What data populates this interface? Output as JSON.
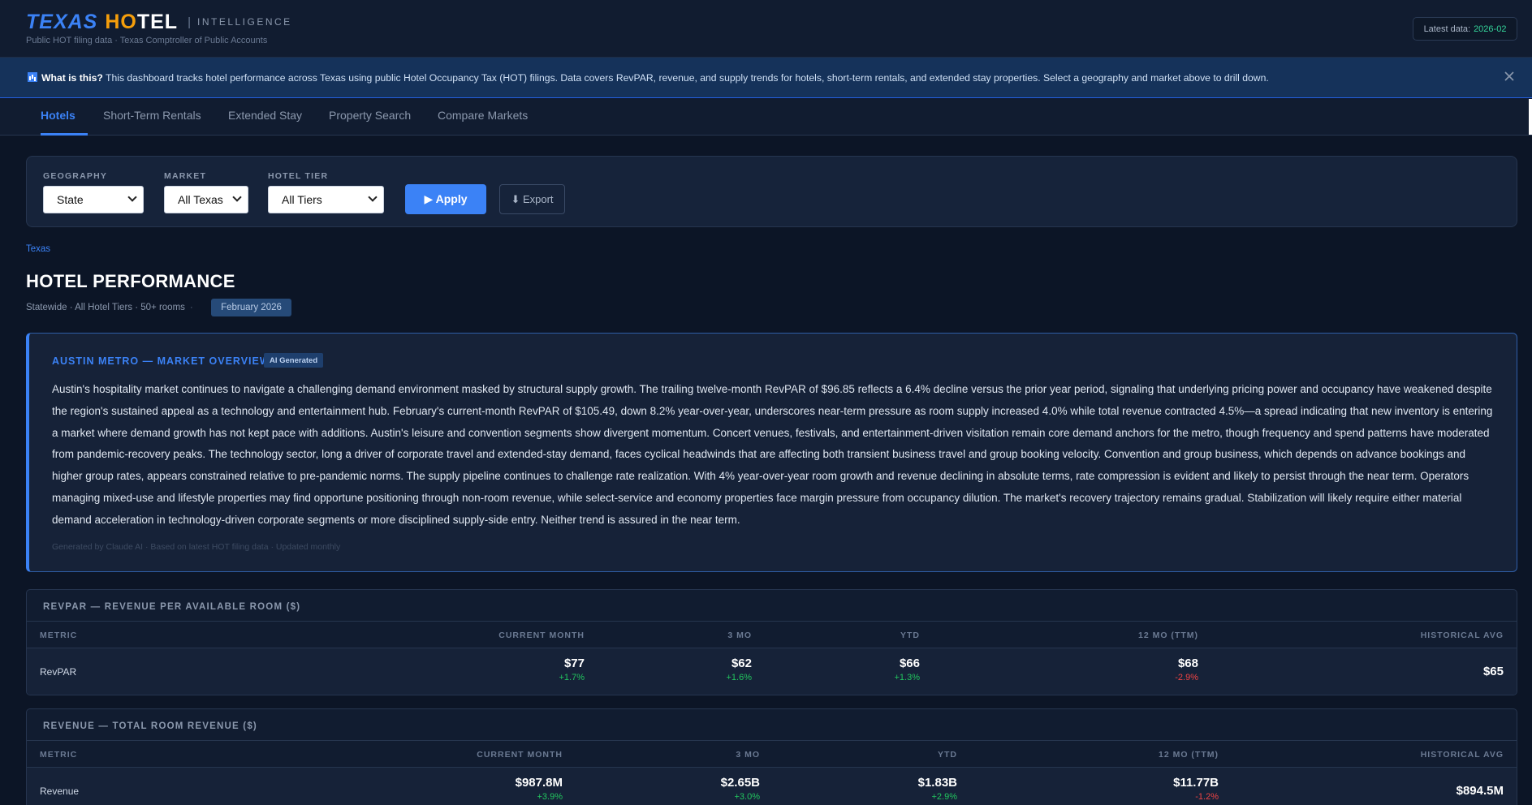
{
  "header": {
    "logo_texas": "TEXAS",
    "logo_hotel_a": "HO",
    "logo_hotel_b": "TEL",
    "logo_sep": "|",
    "logo_intel": "INTELLIGENCE",
    "subtitle": "Public HOT filing data · Texas Comptroller of Public Accounts",
    "latest_label": "Latest data:",
    "latest_value": "2026-02"
  },
  "banner": {
    "icon": "bar-chart-icon",
    "question": "What is this?",
    "text": " This dashboard tracks hotel performance across Texas using public Hotel Occupancy Tax (HOT) filings. Data covers RevPAR, revenue, and supply trends for hotels, short-term rentals, and extended stay properties. Select a geography and market above to drill down."
  },
  "tabs": [
    {
      "label": "Hotels"
    },
    {
      "label": "Short-Term Rentals"
    },
    {
      "label": "Extended Stay"
    },
    {
      "label": "Property Search"
    },
    {
      "label": "Compare Markets"
    }
  ],
  "filters": {
    "geography_label": "GEOGRAPHY",
    "geography_value": "State",
    "market_label": "MARKET",
    "market_value": "All Texas",
    "tier_label": "HOTEL TIER",
    "tier_value": "All Tiers",
    "apply_label": "▶ Apply",
    "export_label": "⬇ Export"
  },
  "page": {
    "breadcrumb": "Texas",
    "title": "HOTEL PERFORMANCE",
    "subtitle": "Statewide · All Hotel Tiers · 50+ rooms",
    "subtitle_dot": "·",
    "period": "February 2026"
  },
  "overview": {
    "title": "AUSTIN METRO — MARKET OVERVIEW",
    "badge": "AI Generated",
    "body": "Austin's hospitality market continues to navigate a challenging demand environment masked by structural supply growth. The trailing twelve-month RevPAR of $96.85 reflects a 6.4% decline versus the prior year period, signaling that underlying pricing power and occupancy have weakened despite the region's sustained appeal as a technology and entertainment hub. February's current-month RevPAR of $105.49, down 8.2% year-over-year, underscores near-term pressure as room supply increased 4.0% while total revenue contracted 4.5%—a spread indicating that new inventory is entering a market where demand growth has not kept pace with additions. Austin's leisure and convention segments show divergent momentum. Concert venues, festivals, and entertainment-driven visitation remain core demand anchors for the metro, though frequency and spend patterns have moderated from pandemic-recovery peaks. The technology sector, long a driver of corporate travel and extended-stay demand, faces cyclical headwinds that are affecting both transient business travel and group booking velocity. Convention and group business, which depends on advance bookings and higher group rates, appears constrained relative to pre-pandemic norms. The supply pipeline continues to challenge rate realization. With 4% year-over-year room growth and revenue declining in absolute terms, rate compression is evident and likely to persist through the near term. Operators managing mixed-use and lifestyle properties may find opportune positioning through non-room revenue, while select-service and economy properties face margin pressure from occupancy dilution. The market's recovery trajectory remains gradual. Stabilization will likely require either material demand acceleration in technology-driven corporate segments or more disciplined supply-side entry. Neither trend is assured in the near term.",
    "footer": "Generated by Claude AI · Based on latest HOT filing data · Updated monthly"
  },
  "revpar_table": {
    "title": "REVPAR — REVENUE PER AVAILABLE ROOM ($)",
    "headers": [
      "METRIC",
      "CURRENT MONTH",
      "3 MO",
      "YTD",
      "12 MO (TTM)",
      "HISTORICAL AVG"
    ],
    "metric": "RevPAR",
    "cells": [
      {
        "value": "$77",
        "change": "+1.7%",
        "dir": "up"
      },
      {
        "value": "$62",
        "change": "+1.6%",
        "dir": "up"
      },
      {
        "value": "$66",
        "change": "+1.3%",
        "dir": "up"
      },
      {
        "value": "$68",
        "change": "-2.9%",
        "dir": "down"
      },
      {
        "value": "$65",
        "change": "",
        "dir": ""
      }
    ]
  },
  "revenue_table": {
    "title": "REVENUE — TOTAL ROOM REVENUE ($)",
    "headers": [
      "METRIC",
      "CURRENT MONTH",
      "3 MO",
      "YTD",
      "12 MO (TTM)",
      "HISTORICAL AVG"
    ],
    "metric": "Revenue",
    "cells": [
      {
        "value": "$987.8M",
        "change": "+3.9%",
        "dir": "up"
      },
      {
        "value": "$2.65B",
        "change": "+3.0%",
        "dir": "up"
      },
      {
        "value": "$1.83B",
        "change": "+2.9%",
        "dir": "up"
      },
      {
        "value": "$11.77B",
        "change": "-1.2%",
        "dir": "down"
      },
      {
        "value": "$894.5M",
        "change": "",
        "dir": ""
      }
    ]
  },
  "colors": {
    "accent": "#3b82f6",
    "brand_orange": "#f59e0b",
    "positive": "#22c55e",
    "negative": "#ef4444",
    "background": "#0c1526"
  }
}
